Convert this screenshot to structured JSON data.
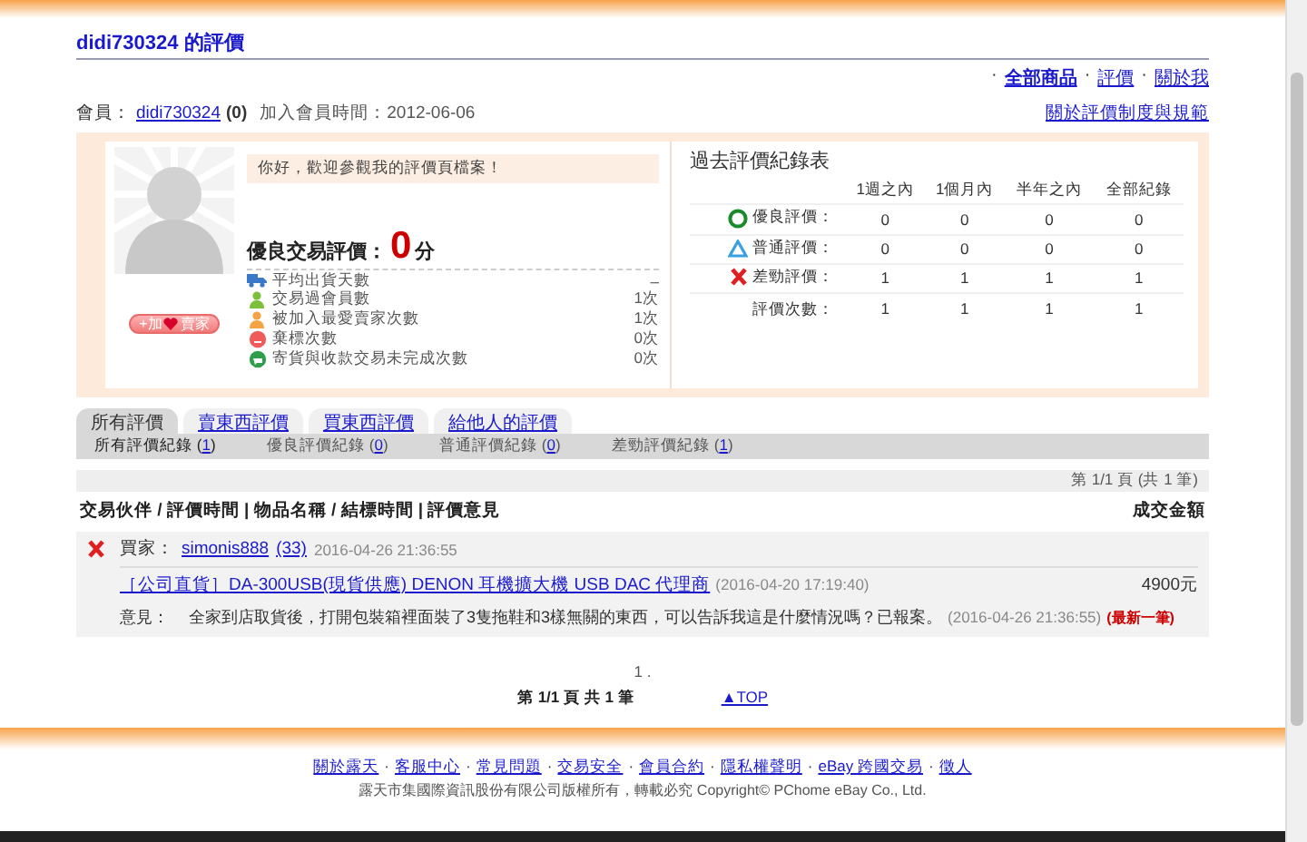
{
  "header": {
    "title": "didi730324 的評價",
    "separator": "·",
    "nav": [
      {
        "label": "全部商品",
        "selected": true
      },
      {
        "label": "評價",
        "selected": false
      },
      {
        "label": "關於我",
        "selected": false
      }
    ]
  },
  "member": {
    "label": "會員：",
    "name": "didi730324",
    "score": "(0)",
    "joined": "加入會員時間：2012-06-06",
    "rules_link": "關於評價制度與規範"
  },
  "profile": {
    "greeting": "你好，歡迎參觀我的評價頁檔案！",
    "follow_button": {
      "before": "+加",
      "after": "賣家"
    },
    "rating_label": "優良交易評價：",
    "rating_value": "0",
    "rating_unit": "分",
    "stats": [
      {
        "kind": "truck",
        "label": "平均出貨天數",
        "value": "–"
      },
      {
        "kind": "member",
        "label": "交易過會員數",
        "value": "1次"
      },
      {
        "kind": "favorite",
        "label": "被加入最愛賣家次數",
        "value": "1次"
      },
      {
        "kind": "abandon",
        "label": "棄標次數",
        "value": "0次"
      },
      {
        "kind": "unfinished",
        "label": "寄貨與收款交易未完成次數",
        "value": "0次"
      }
    ]
  },
  "history": {
    "title": "過去評價紀錄表",
    "columns": [
      "1週之內",
      "1個月內",
      "半年之內",
      "全部紀錄"
    ],
    "rows": [
      {
        "kind": "positive",
        "label": "優良評價：",
        "values": [
          "0",
          "0",
          "0",
          "0"
        ]
      },
      {
        "kind": "neutral",
        "label": "普通評價：",
        "values": [
          "0",
          "0",
          "0",
          "0"
        ]
      },
      {
        "kind": "negative",
        "label": "差勁評價：",
        "values": [
          "1",
          "1",
          "1",
          "1"
        ]
      },
      {
        "kind": "total",
        "label": "評價次數：",
        "values": [
          "1",
          "1",
          "1",
          "1"
        ]
      }
    ]
  },
  "tabs": [
    {
      "label": "所有評價",
      "selected": true
    },
    {
      "label": "賣東西評價",
      "selected": false
    },
    {
      "label": "買東西評價",
      "selected": false
    },
    {
      "label": "給他人的評價",
      "selected": false
    }
  ],
  "filters": [
    {
      "prefix": "所有評價紀錄 (",
      "count": "1",
      "suffix": ")",
      "selected": true
    },
    {
      "prefix": "優良評價紀錄 (",
      "count": "0",
      "suffix": ")",
      "selected": false
    },
    {
      "prefix": "普通評價紀錄 (",
      "count": "0",
      "suffix": ")",
      "selected": false
    },
    {
      "prefix": "差勁評價紀錄 (",
      "count": "1",
      "suffix": ")",
      "selected": false
    }
  ],
  "pager_top": "第 1/1 頁 (共 1 筆)",
  "list_header": {
    "left": "交易伙伴 / 評價時間 | 物品名稱 / 結標時間 | 評價意見",
    "right": "成交金額"
  },
  "records": [
    {
      "kind": "negative",
      "role": "買家：",
      "partner": "simonis888",
      "partner_score": "(33)",
      "time": "2016-04-26 21:36:55",
      "item": "［公司直貨］DA-300USB(現貨供應) DENON 耳機擴大機 USB DAC 代理商",
      "item_time": "(2016-04-20 17:19:40)",
      "price": "4900元",
      "comment_label": "意見：",
      "comment": "全家到店取貨後，打開包裝箱裡面裝了3隻拖鞋和3樣無關的東西，可以告訴我這是什麼情況嗎？已報案。",
      "comment_time": "(2016-04-26 21:36:55)",
      "latest": "(最新一筆)"
    }
  ],
  "pagination": {
    "pages": "1 .",
    "summary": "第 1/1 頁 共 1 筆",
    "top": "▲TOP"
  },
  "footer": {
    "separator": "·",
    "links": [
      "關於露天",
      "客服中心",
      "常見問題",
      "交易安全",
      "會員合約",
      "隱私權聲明",
      "eBay 跨國交易",
      "徵人"
    ],
    "copyright": "露天市集國際資訊股份有限公司版權所有，轉載必究 Copyright©  PChome eBay Co., Ltd."
  }
}
